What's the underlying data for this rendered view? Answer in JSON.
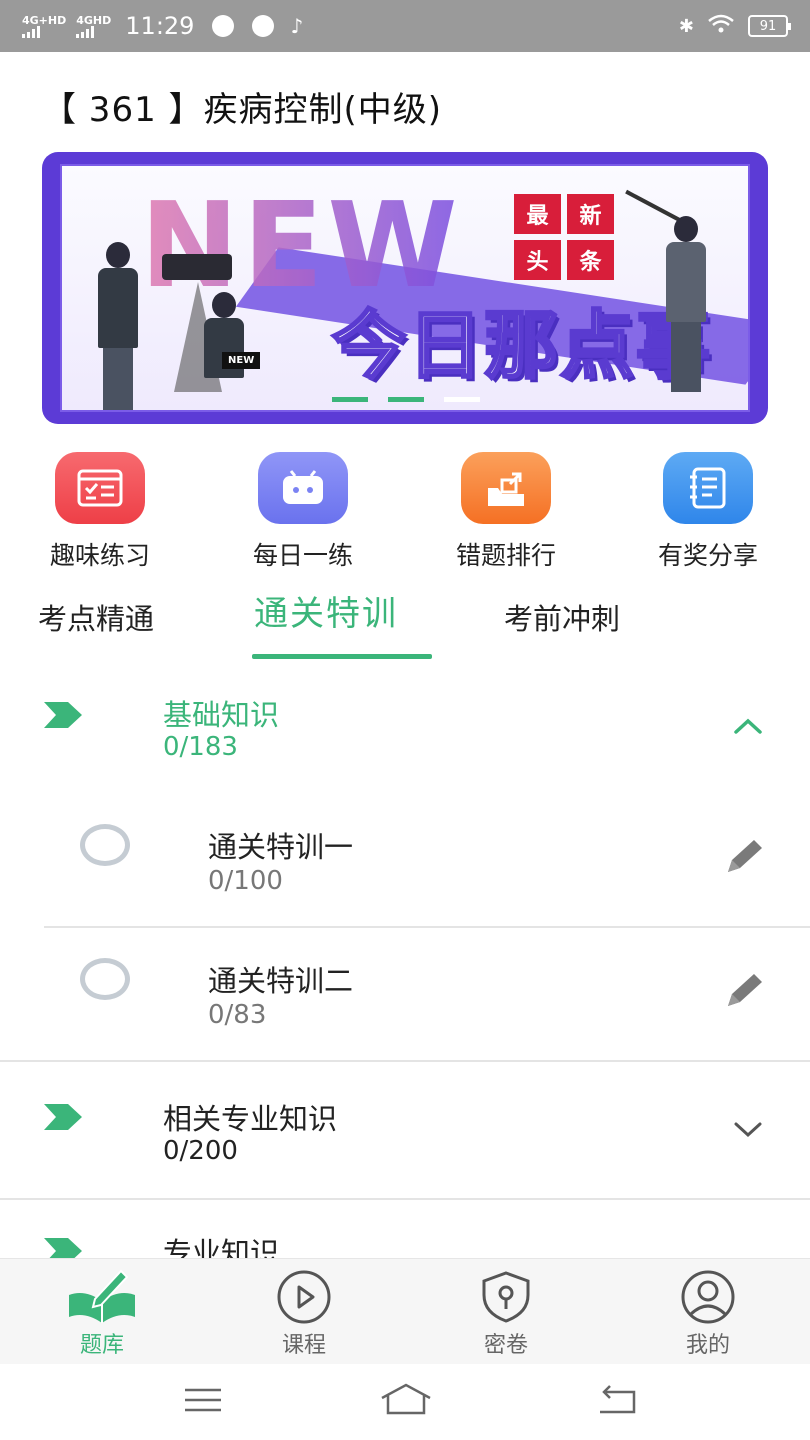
{
  "status_bar": {
    "net1": "4G+HD",
    "net2": "4GHD",
    "time": "11:29",
    "battery": "91"
  },
  "page_title": "【 361 】疾病控制(中级)",
  "banner": {
    "big_text": "NEW",
    "badge": [
      "最",
      "新",
      "头",
      "条"
    ],
    "slogan": "今日那点事",
    "chair_sign": "NEW",
    "dots": 3,
    "active_dot": 2
  },
  "quick_actions": [
    {
      "label": "趣味练习",
      "icon": "practice-form-icon",
      "color": "#f2545b"
    },
    {
      "label": "每日一练",
      "icon": "daily-box-icon",
      "color": "#7b83f3"
    },
    {
      "label": "错题排行",
      "icon": "mistake-export-icon",
      "color": "#f9843c"
    },
    {
      "label": "有奖分享",
      "icon": "notebook-icon",
      "color": "#3c93ef"
    }
  ],
  "tabs": [
    {
      "label": "考点精通",
      "active": false
    },
    {
      "label": "通关特训",
      "active": true
    },
    {
      "label": "考前冲刺",
      "active": false
    }
  ],
  "sections": [
    {
      "title": "基础知识",
      "count": "0/183",
      "expanded": true,
      "items": [
        {
          "title": "通关特训一",
          "count": "0/100"
        },
        {
          "title": "通关特训二",
          "count": "0/83"
        }
      ]
    },
    {
      "title": "相关专业知识",
      "count": "0/200",
      "expanded": false
    },
    {
      "title": "专业知识",
      "count": "",
      "expanded": false
    }
  ],
  "bottom_nav": [
    {
      "label": "题库",
      "icon": "book-pen-icon",
      "active": true
    },
    {
      "label": "课程",
      "icon": "play-circle-icon",
      "active": false
    },
    {
      "label": "密卷",
      "icon": "shield-lock-icon",
      "active": false
    },
    {
      "label": "我的",
      "icon": "user-circle-icon",
      "active": false
    }
  ],
  "colors": {
    "accent": "#3bb57a",
    "banner": "#5c3bd6",
    "status_bar": "#9a9a9a"
  }
}
